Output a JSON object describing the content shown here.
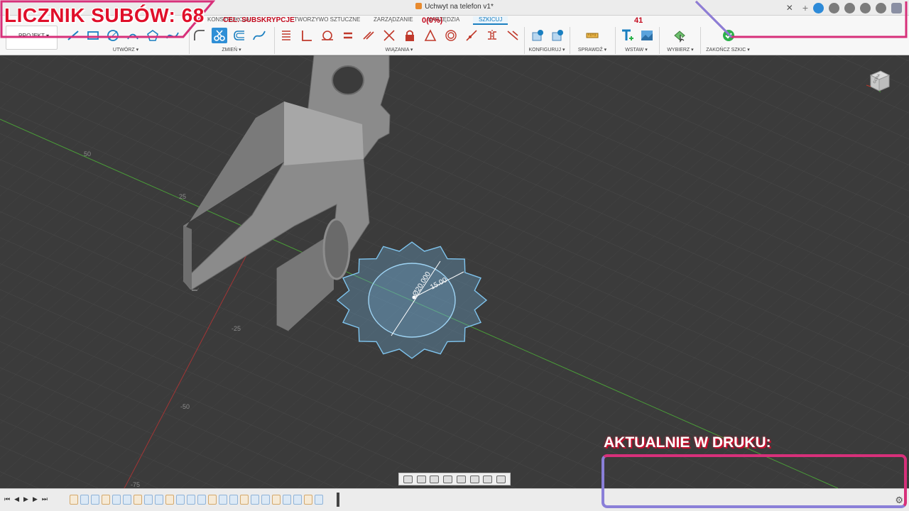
{
  "window": {
    "doc_title": "Uchwyt na telefon v1*"
  },
  "ribbon": {
    "project_label": "PROJEKT ▾",
    "tabs": [
      {
        "label": "KONSTRUKCJA"
      },
      {
        "label": "TWORZYWO SZTUCZNE"
      },
      {
        "label": "ZARZĄDZANIE"
      },
      {
        "label": "NARZĘDZIA"
      },
      {
        "label": "SZKICUJ",
        "active": true
      }
    ],
    "groups": {
      "create": "UTWÓRZ ▾",
      "modify": "ZMIEŃ ▾",
      "constraints": "WIĄZANIA ▾",
      "configure": "KONFIGURUJ ▾",
      "inspect": "SPRAWDŹ ▾",
      "insert": "WSTAW ▾",
      "select": "WYBIERZ ▾",
      "finish": "ZAKOŃCZ SZKIC ▾"
    }
  },
  "viewport": {
    "axis_labels": [
      "50",
      "25",
      "-25",
      "-50",
      "-75"
    ],
    "sketch": {
      "diameter_dim": "Ø20.000",
      "radius_dim": "15.00"
    },
    "viewcube_face": "GÓRA"
  },
  "overlay": {
    "sub_counter": "LICZNIK SUBÓW: 68",
    "goal_label": "CEL: SUBSKRYPCJE",
    "goal_progress": "0(0%)",
    "goal_target": "41",
    "printing_label": "AKTUALNIE W DRUKU:"
  },
  "colors": {
    "accent": "#1a7fc0",
    "overlay_red": "#e00f2a",
    "frame_pink": "#d7307a",
    "frame_purple": "#8a7fd8",
    "sketch_blue": "#7fc4ee",
    "model_gray": "#8a8a8a"
  },
  "icons": [
    "undo-icon",
    "redo-icon",
    "line-icon",
    "rectangle-icon",
    "circle-icon",
    "arc-icon",
    "spline-icon",
    "fillet-icon",
    "trim-icon",
    "offset-icon",
    "coincident-icon",
    "collinear-icon",
    "tangent-icon",
    "equal-icon",
    "parallel-icon",
    "perpendicular-icon",
    "fix-icon",
    "midpoint-icon",
    "concentric-icon",
    "symmetry-icon",
    "measure-icon",
    "insert-text-icon",
    "insert-image-icon",
    "select-icon",
    "finish-sketch-icon",
    "gear-icon"
  ]
}
